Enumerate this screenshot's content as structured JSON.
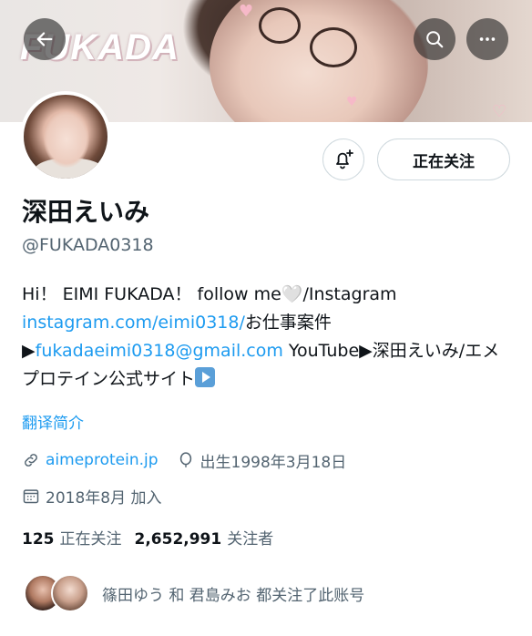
{
  "banner": {
    "text": "FUKADA"
  },
  "header": {
    "back_icon": "arrow-left-icon",
    "search_icon": "search-icon",
    "more_icon": "more-horizontal-icon"
  },
  "profile": {
    "name": "深田えいみ",
    "handle": "@FUKADA0318",
    "bell_icon": "bell-plus-icon",
    "follow_label": "正在关注"
  },
  "bio": {
    "line1_text": "Hi！ EIMI FUKADA！ follow me🤍/Instagram",
    "instagram_link": "instagram.com/eimi0318/",
    "line2_suffix": "お仕事案件",
    "arrow1": "▶",
    "email_link": "fukadaeimi0318@gmail.com",
    "line3_suffix": " YouTube▶深田えいみ/エメプロテイン公式サイト",
    "play_icon": "play-button-icon"
  },
  "translate_label": "翻译简介",
  "meta": {
    "website": "aimeprotein.jp",
    "birth": "出生1998年3月18日",
    "joined": "2018年8月 加入"
  },
  "counts": {
    "following_num": "125",
    "following_label": "正在关注",
    "followers_num": "2,652,991",
    "followers_label": "关注者"
  },
  "mutual_text": "篠田ゆう 和 君島みお 都关注了此账号",
  "colors": {
    "link": "#1d9bf0",
    "secondary": "#536471",
    "primary": "#0f1419"
  }
}
